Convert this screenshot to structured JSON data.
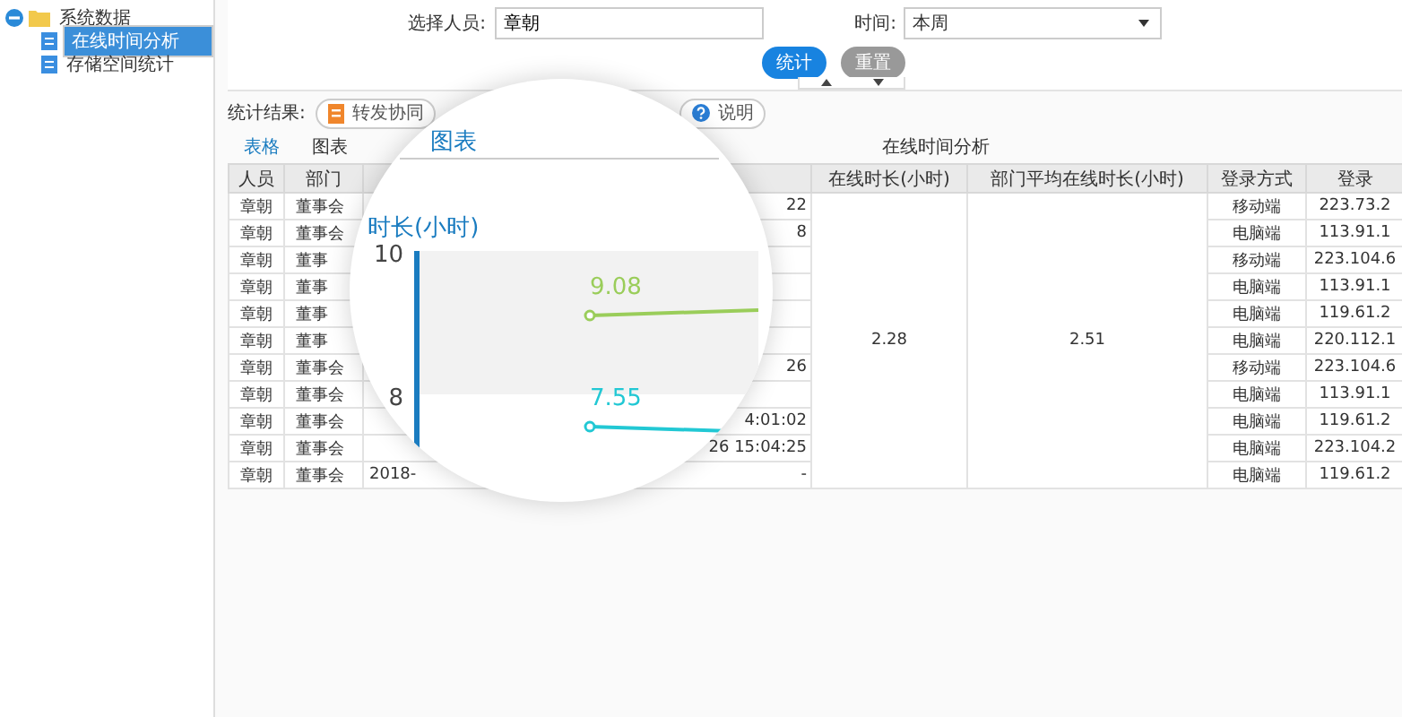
{
  "sidebar": {
    "tree": [
      {
        "label": "系统数据",
        "expanded": true,
        "children": [
          {
            "label": "在线时间分析",
            "selected": true
          },
          {
            "label": "存储空间统计",
            "selected": false
          }
        ]
      }
    ]
  },
  "filters": {
    "person": {
      "label": "选择人员:",
      "value": "章朝"
    },
    "time": {
      "label": "时间:",
      "value": "本周"
    }
  },
  "buttons": [
    {
      "label": "统计",
      "kind": "primary"
    },
    {
      "label": "重置",
      "kind": "secondary"
    }
  ],
  "toolbar": {
    "label": "统计结果:",
    "buttons": [
      {
        "label": "转发协同",
        "kind": "forward"
      },
      {
        "label": "说明",
        "kind": "help"
      }
    ]
  },
  "view_tabs": [
    {
      "label": "表格",
      "selected": true
    },
    {
      "label": "图表",
      "selected": false
    }
  ],
  "table": {
    "title": "在线时间分析",
    "columns": [
      "人员",
      "部门",
      "在线时长(小时)",
      "部门平均在线时长(小时)",
      "登录方式",
      "登录"
    ],
    "online_hours": "2.28",
    "dept_average": "2.51",
    "rows": [
      {
        "person": "章朝",
        "department": "董事会",
        "column_4": "22",
        "login_method": "移动端",
        "column_8": "223.73.2"
      },
      {
        "person": "章朝",
        "department": "董事会",
        "column_4": "8",
        "login_method": "电脑端",
        "column_8": "113.91.1"
      },
      {
        "person": "章朝",
        "department": "董事",
        "login_method": "移动端",
        "column_8": "223.104.6"
      },
      {
        "person": "章朝",
        "department": "董事",
        "login_method": "电脑端",
        "column_8": "113.91.1"
      },
      {
        "person": "章朝",
        "department": "董事",
        "login_method": "电脑端",
        "column_8": "119.61.2"
      },
      {
        "person": "章朝",
        "department": "董事",
        "login_method": "电脑端",
        "column_8": "220.112.1"
      },
      {
        "person": "章朝",
        "department": "董事会",
        "column_4": "26",
        "login_method": "移动端",
        "column_8": "223.104.6"
      },
      {
        "person": "章朝",
        "department": "董事会",
        "login_method": "电脑端",
        "column_8": "113.91.1"
      },
      {
        "person": "章朝",
        "department": "董事会",
        "column_4": "4:01:02",
        "login_method": "电脑端",
        "column_8": "119.61.2"
      },
      {
        "person": "章朝",
        "department": "董事会",
        "column_4": "26 15:04:25",
        "login_method": "电脑端",
        "column_8": "223.104.2"
      },
      {
        "person": "章朝",
        "department": "董事会",
        "column_3": "2018-",
        "column_4": "-",
        "login_method": "电脑端",
        "column_8": "119.61.2"
      }
    ]
  },
  "magnifier": {
    "title": "图表",
    "axis_label": "时长(小时)",
    "ticks": [
      "10",
      "8"
    ],
    "lines": [
      {
        "label": "9.08",
        "color": "#9acd5a"
      },
      {
        "label": "7.55",
        "color": "#22c8d4"
      }
    ]
  }
}
